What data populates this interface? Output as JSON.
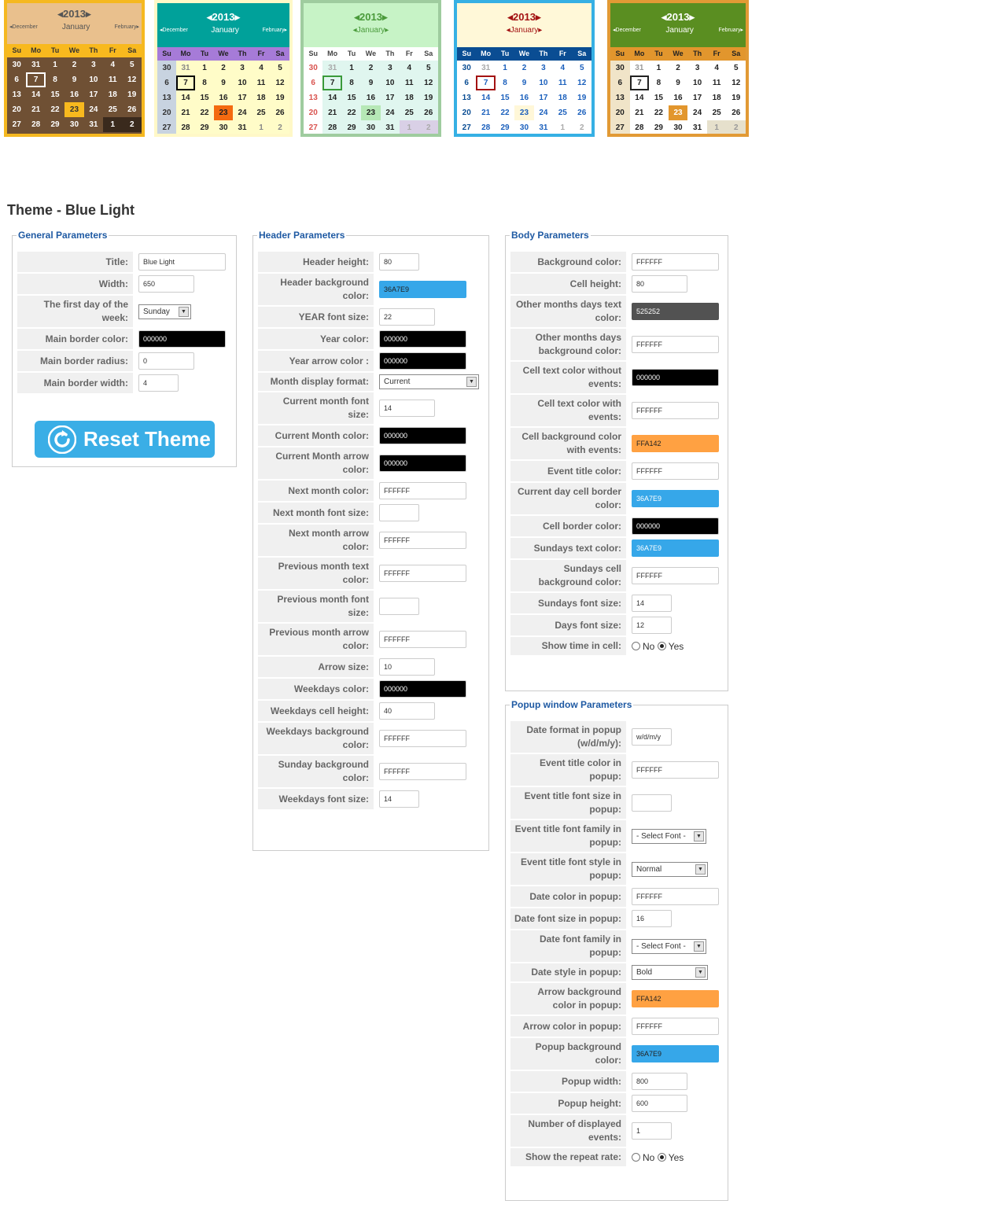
{
  "theme_thumbnails": [
    {
      "year": "2013",
      "month": "January",
      "prev_month": "December",
      "next_month": "February",
      "weekdays": [
        "Su",
        "Mo",
        "Tu",
        "We",
        "Th",
        "Fr",
        "Sa"
      ],
      "weeks": [
        [
          "30",
          "31",
          "1",
          "2",
          "3",
          "4",
          "5"
        ],
        [
          "6",
          "7",
          "8",
          "9",
          "10",
          "11",
          "12"
        ],
        [
          "13",
          "14",
          "15",
          "16",
          "17",
          "18",
          "19"
        ],
        [
          "20",
          "21",
          "22",
          "23",
          "24",
          "25",
          "26"
        ],
        [
          "27",
          "28",
          "29",
          "30",
          "31",
          "1",
          "2"
        ]
      ]
    },
    {
      "year": "2013",
      "month": "January",
      "prev_month": "December",
      "next_month": "February",
      "weekdays": [
        "Su",
        "Mo",
        "Tu",
        "We",
        "Th",
        "Fr",
        "Sa"
      ],
      "weeks": [
        [
          "30",
          "31",
          "1",
          "2",
          "3",
          "4",
          "5"
        ],
        [
          "6",
          "7",
          "8",
          "9",
          "10",
          "11",
          "12"
        ],
        [
          "13",
          "14",
          "15",
          "16",
          "17",
          "18",
          "19"
        ],
        [
          "20",
          "21",
          "22",
          "23",
          "24",
          "25",
          "26"
        ],
        [
          "27",
          "28",
          "29",
          "30",
          "31",
          "1",
          "2"
        ]
      ]
    },
    {
      "year": "2013",
      "month": "January",
      "prev_month": "",
      "next_month": "",
      "weekdays": [
        "Su",
        "Mo",
        "Tu",
        "We",
        "Th",
        "Fr",
        "Sa"
      ],
      "weeks": [
        [
          "30",
          "31",
          "1",
          "2",
          "3",
          "4",
          "5"
        ],
        [
          "6",
          "7",
          "8",
          "9",
          "10",
          "11",
          "12"
        ],
        [
          "13",
          "14",
          "15",
          "16",
          "17",
          "18",
          "19"
        ],
        [
          "20",
          "21",
          "22",
          "23",
          "24",
          "25",
          "26"
        ],
        [
          "27",
          "28",
          "29",
          "30",
          "31",
          "1",
          "2"
        ]
      ]
    },
    {
      "year": "2013",
      "month": "January",
      "prev_month": "",
      "next_month": "",
      "weekdays": [
        "Su",
        "Mo",
        "Tu",
        "We",
        "Th",
        "Fr",
        "Sa"
      ],
      "weeks": [
        [
          "30",
          "31",
          "1",
          "2",
          "3",
          "4",
          "5"
        ],
        [
          "6",
          "7",
          "8",
          "9",
          "10",
          "11",
          "12"
        ],
        [
          "13",
          "14",
          "15",
          "16",
          "17",
          "18",
          "19"
        ],
        [
          "20",
          "21",
          "22",
          "23",
          "24",
          "25",
          "26"
        ],
        [
          "27",
          "28",
          "29",
          "30",
          "31",
          "1",
          "2"
        ]
      ]
    },
    {
      "year": "2013",
      "month": "January",
      "prev_month": "December",
      "next_month": "February",
      "weekdays": [
        "Su",
        "Mo",
        "Tu",
        "We",
        "Th",
        "Fr",
        "Sa"
      ],
      "weeks": [
        [
          "30",
          "31",
          "1",
          "2",
          "3",
          "4",
          "5"
        ],
        [
          "6",
          "7",
          "8",
          "9",
          "10",
          "11",
          "12"
        ],
        [
          "13",
          "14",
          "15",
          "16",
          "17",
          "18",
          "19"
        ],
        [
          "20",
          "21",
          "22",
          "23",
          "24",
          "25",
          "26"
        ],
        [
          "27",
          "28",
          "29",
          "30",
          "31",
          "1",
          "2"
        ]
      ]
    }
  ],
  "page_title": "Theme - Blue Light",
  "general": {
    "legend": "General Parameters",
    "title_label": "Title:",
    "title_value": "Blue Light",
    "width_label": "Width:",
    "width_value": "650",
    "first_day_label": "The first day of the week:",
    "first_day_value": "Sunday",
    "border_color_label": "Main border color:",
    "border_color_value": "000000",
    "border_radius_label": "Main border radius:",
    "border_radius_value": "0",
    "border_width_label": "Main border width:",
    "border_width_value": "4",
    "reset_label": "Reset Theme"
  },
  "header": {
    "legend": "Header Parameters",
    "height_label": "Header height:",
    "height_value": "80",
    "bg_label": "Header background color:",
    "bg_value": "36A7E9",
    "year_size_label": "YEAR font size:",
    "year_size_value": "22",
    "year_color_label": "Year color:",
    "year_color_value": "000000",
    "year_arrow_label": "Year arrow color :",
    "year_arrow_value": "000000",
    "month_format_label": "Month display format:",
    "month_format_value": "Current",
    "cur_month_size_label": "Current month font size:",
    "cur_month_size_value": "14",
    "cur_month_color_label": "Current Month color:",
    "cur_month_color_value": "000000",
    "cur_month_arrow_label": "Current Month arrow color:",
    "cur_month_arrow_value": "000000",
    "next_month_color_label": "Next month color:",
    "next_month_color_value": "FFFFFF",
    "next_month_size_label": "Next month font size:",
    "next_month_size_value": "",
    "next_month_arrow_label": "Next month arrow color:",
    "next_month_arrow_value": "FFFFFF",
    "prev_month_text_label": "Previous month text color:",
    "prev_month_text_value": "FFFFFF",
    "prev_month_size_label": "Previous month font size:",
    "prev_month_size_value": "",
    "prev_month_arrow_label": "Previous month arrow color:",
    "prev_month_arrow_value": "FFFFFF",
    "arrow_size_label": "Arrow size:",
    "arrow_size_value": "10",
    "weekdays_color_label": "Weekdays color:",
    "weekdays_color_value": "000000",
    "weekdays_height_label": "Weekdays cell height:",
    "weekdays_height_value": "40",
    "weekdays_bg_label": "Weekdays background color:",
    "weekdays_bg_value": "FFFFFF",
    "sunday_bg_label": "Sunday background color:",
    "sunday_bg_value": "FFFFFF",
    "weekdays_size_label": "Weekdays font size:",
    "weekdays_size_value": "14"
  },
  "body": {
    "legend": "Body Parameters",
    "bg_label": "Background color:",
    "bg_value": "FFFFFF",
    "cell_height_label": "Cell height:",
    "cell_height_value": "80",
    "other_text_label": "Other months days text color:",
    "other_text_value": "525252",
    "other_bg_label": "Other months days background color:",
    "other_bg_value": "FFFFFF",
    "text_no_events_label": "Cell text color without events:",
    "text_no_events_value": "000000",
    "text_events_label": "Cell text color with events:",
    "text_events_value": "FFFFFF",
    "bg_events_label": "Cell background color with events:",
    "bg_events_value": "FFA142",
    "event_title_label": "Event title color:",
    "event_title_value": "FFFFFF",
    "current_border_label": "Current day cell border color:",
    "current_border_value": "36A7E9",
    "cell_border_label": "Cell border color:",
    "cell_border_value": "000000",
    "sundays_text_label": "Sundays text color:",
    "sundays_text_value": "36A7E9",
    "sundays_bg_label": "Sundays cell background color:",
    "sundays_bg_value": "FFFFFF",
    "sundays_size_label": "Sundays font size:",
    "sundays_size_value": "14",
    "days_size_label": "Days font size:",
    "days_size_value": "12",
    "show_time_label": "Show time in cell:",
    "no_label": "No",
    "yes_label": "Yes"
  },
  "popup": {
    "legend": "Popup window Parameters",
    "date_format_label": "Date format in popup (w/d/m/y):",
    "date_format_value": "w/d/m/y",
    "title_color_label": "Event title color in popup:",
    "title_color_value": "FFFFFF",
    "title_size_label": "Event title font size in popup:",
    "title_size_value": "",
    "title_family_label": "Event title font family in popup:",
    "title_family_value": "- Select Font -",
    "title_style_label": "Event title font style in popup:",
    "title_style_value": "Normal",
    "date_color_label": "Date color in popup:",
    "date_color_value": "FFFFFF",
    "date_size_label": "Date font size in popup:",
    "date_size_value": "16",
    "date_family_label": "Date font family in popup:",
    "date_family_value": "- Select Font -",
    "date_style_label": "Date style in popup:",
    "date_style_value": "Bold",
    "arrow_bg_label": "Arrow background color in popup:",
    "arrow_bg_value": "FFA142",
    "arrow_color_label": "Arrow color in popup:",
    "arrow_color_value": "FFFFFF",
    "bg_label": "Popup background color:",
    "bg_value": "36A7E9",
    "width_label": "Popup width:",
    "width_value": "800",
    "height_label": "Popup height:",
    "height_value": "600",
    "events_label": "Number of displayed events:",
    "events_value": "1",
    "repeat_label": "Show the repeat rate:",
    "no_label": "No",
    "yes_label": "Yes"
  }
}
